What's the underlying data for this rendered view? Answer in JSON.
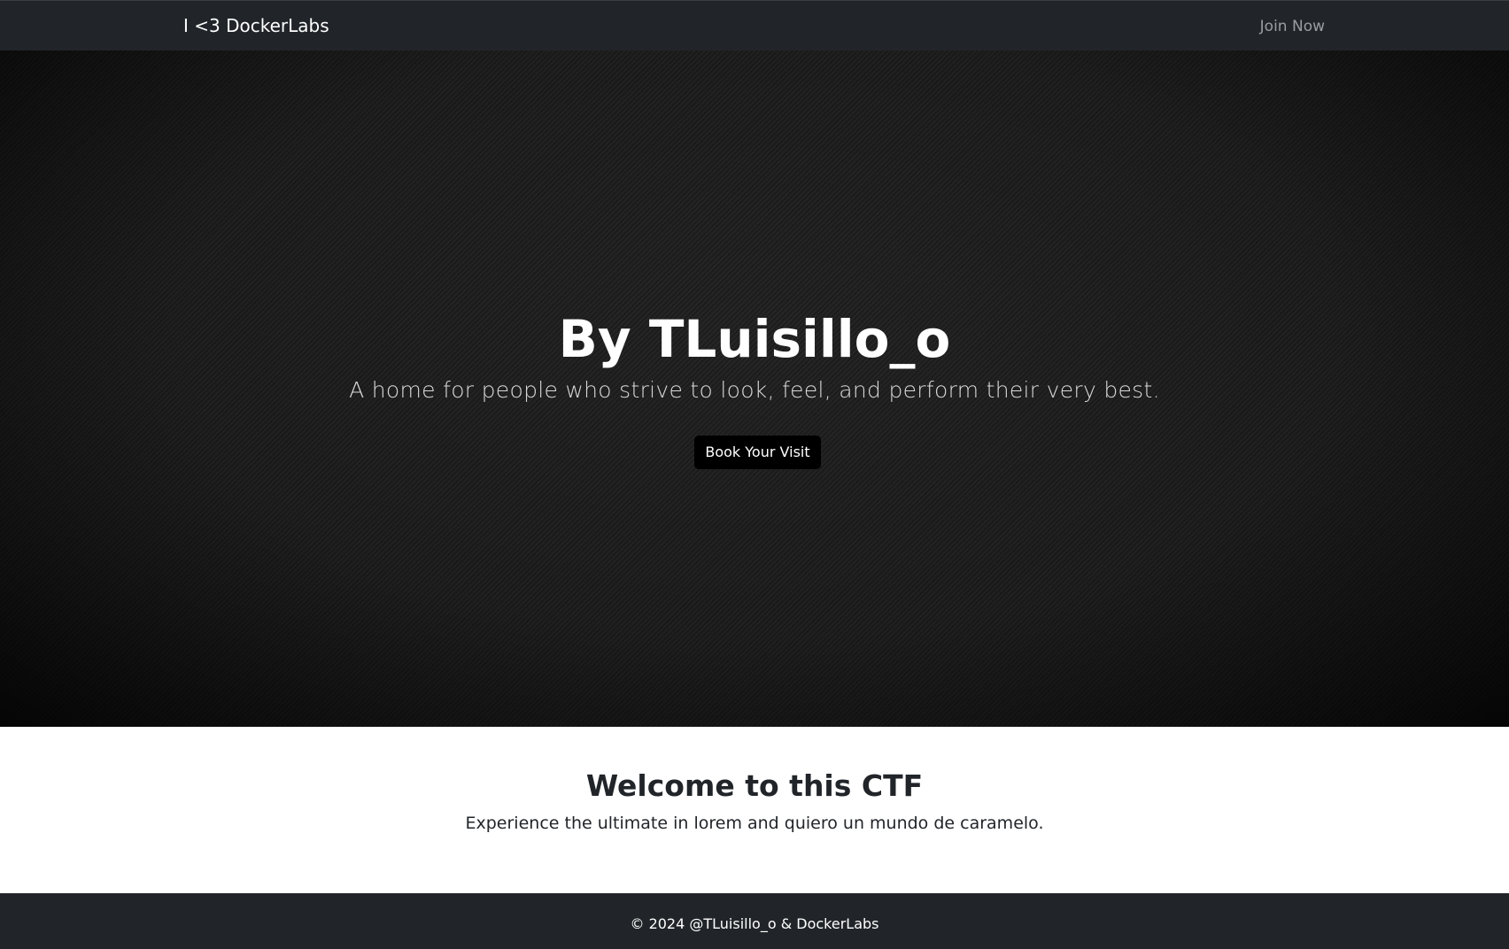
{
  "navbar": {
    "brand": "I <3 DockerLabs",
    "join_link": "Join Now"
  },
  "hero": {
    "title": "By TLuisillo_o",
    "subtitle": "A home for people who strive to look, feel, and perform their very best.",
    "button_label": "Book Your Visit"
  },
  "welcome": {
    "title": "Welcome to this CTF",
    "text": "Experience the ultimate in lorem and quiero un mundo de caramelo."
  },
  "footer": {
    "copyright": "© 2024 @TLuisillo_o & DockerLabs"
  },
  "colors": {
    "navbar_bg": "#212529",
    "hero_bg": "#1f1f1f",
    "button_bg": "#000000",
    "text_dark": "#212529",
    "nav_link": "#9a9da1"
  }
}
